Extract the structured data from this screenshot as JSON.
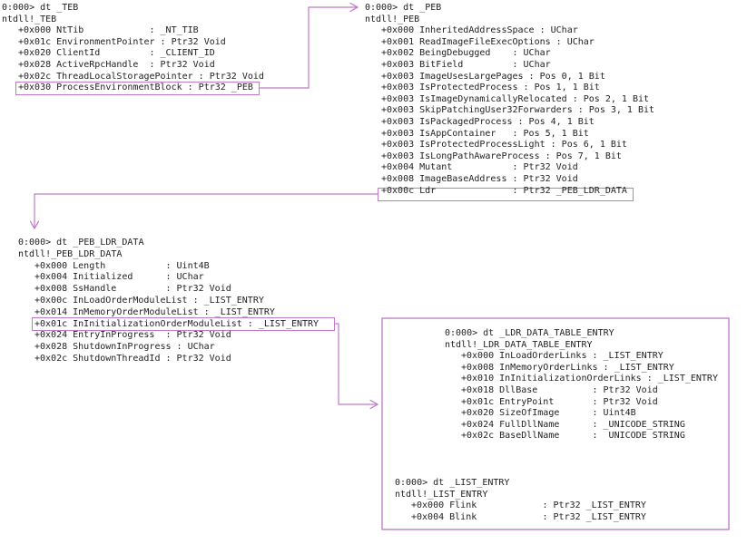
{
  "colors": {
    "connector": "#c07ac8",
    "text": "#222222"
  },
  "teb": {
    "prompt": "0:000> dt _TEB",
    "type": "ntdll!_TEB",
    "fields": [
      "+0x000 NtTib            : _NT_TIB",
      "+0x01c EnvironmentPointer : Ptr32 Void",
      "+0x020 ClientId         : _CLIENT_ID",
      "+0x028 ActiveRpcHandle  : Ptr32 Void",
      "+0x02c ThreadLocalStoragePointer : Ptr32 Void",
      "+0x030 ProcessEnvironmentBlock : Ptr32 _PEB"
    ]
  },
  "peb": {
    "prompt": "0:000> dt _PEB",
    "type": "ntdll!_PEB",
    "fields": [
      "+0x000 InheritedAddressSpace : UChar",
      "+0x001 ReadImageFileExecOptions : UChar",
      "+0x002 BeingDebugged    : UChar",
      "+0x003 BitField         : UChar",
      "+0x003 ImageUsesLargePages : Pos 0, 1 Bit",
      "+0x003 IsProtectedProcess : Pos 1, 1 Bit",
      "+0x003 IsImageDynamicallyRelocated : Pos 2, 1 Bit",
      "+0x003 SkipPatchingUser32Forwarders : Pos 3, 1 Bit",
      "+0x003 IsPackagedProcess : Pos 4, 1 Bit",
      "+0x003 IsAppContainer   : Pos 5, 1 Bit",
      "+0x003 IsProtectedProcessLight : Pos 6, 1 Bit",
      "+0x003 IsLongPathAwareProcess : Pos 7, 1 Bit",
      "+0x004 Mutant           : Ptr32 Void",
      "+0x008 ImageBaseAddress : Ptr32 Void",
      "+0x00c Ldr              : Ptr32 _PEB_LDR_DATA"
    ]
  },
  "ldr": {
    "prompt": "0:000> dt _PEB_LDR_DATA",
    "type": "ntdll!_PEB_LDR_DATA",
    "fields": [
      "+0x000 Length           : Uint4B",
      "+0x004 Initialized      : UChar",
      "+0x008 SsHandle         : Ptr32 Void",
      "+0x00c InLoadOrderModuleList : _LIST_ENTRY",
      "+0x014 InMemoryOrderModuleList : _LIST_ENTRY",
      "+0x01c InInitializationOrderModuleList : _LIST_ENTRY",
      "+0x024 EntryInProgress  : Ptr32 Void",
      "+0x028 ShutdownInProgress : UChar",
      "+0x02c ShutdownThreadId : Ptr32 Void"
    ]
  },
  "ldte": {
    "prompt": "0:000> dt _LDR_DATA_TABLE_ENTRY",
    "type": "ntdll!_LDR_DATA_TABLE_ENTRY",
    "fields": [
      "+0x000 InLoadOrderLinks : _LIST_ENTRY",
      "+0x008 InMemoryOrderLinks : _LIST_ENTRY",
      "+0x010 InInitializationOrderLinks : _LIST_ENTRY",
      "+0x018 DllBase          : Ptr32 Void",
      "+0x01c EntryPoint       : Ptr32 Void",
      "+0x020 SizeOfImage      : Uint4B",
      "+0x024 FullDllName      : _UNICODE_STRING",
      "+0x02c BaseDllName      :  UNICODE STRING"
    ]
  },
  "le": {
    "prompt": "0:000> dt _LIST_ENTRY",
    "type": "ntdll!_LIST_ENTRY",
    "fields": [
      "+0x000 Flink            : Ptr32 _LIST_ENTRY",
      "+0x004 Blink            : Ptr32 _LIST_ENTRY"
    ]
  }
}
